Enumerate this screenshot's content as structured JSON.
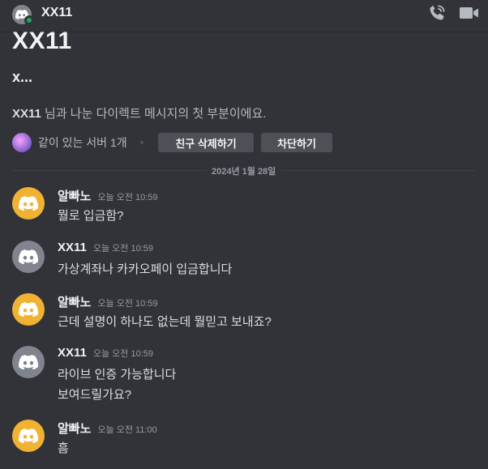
{
  "header": {
    "title": "XX11"
  },
  "profile": {
    "name": "XX11",
    "subname": "x...",
    "intro_name": "XX11",
    "intro_rest": " 님과 나눈 다이렉트 메시지의 첫 부분이에요.",
    "mutual_servers": "같이 있는 서버 1개",
    "remove_friend": "친구 삭제하기",
    "block": "차단하기"
  },
  "date_divider": "2024년 1월 28일",
  "messages": [
    {
      "author": "알빠노",
      "time": "오늘 오전 10:59",
      "avatar_color": "yellow",
      "lines": [
        "뭘로 입금함?"
      ]
    },
    {
      "author": "XX11",
      "time": "오늘 오전 10:59",
      "avatar_color": "gray",
      "lines": [
        "가상계좌나 카카오페이 입금합니다"
      ]
    },
    {
      "author": "알빠노",
      "time": "오늘 오전 10:59",
      "avatar_color": "yellow",
      "lines": [
        "근데 설명이 하나도 없는데 뭘믿고 보내죠?"
      ]
    },
    {
      "author": "XX11",
      "time": "오늘 오전 10:59",
      "avatar_color": "gray",
      "lines": [
        "라이브 인증 가능합니다",
        "보여드릴가요?"
      ]
    },
    {
      "author": "알빠노",
      "time": "오늘 오전 11:00",
      "avatar_color": "yellow",
      "lines": [
        "흠"
      ]
    }
  ],
  "icons": {
    "discord": "discord-logo-icon",
    "call": "phone-call-icon",
    "video": "video-camera-icon",
    "server": "server-icon"
  },
  "colors": {
    "background": "#313338",
    "online": "#23a55a",
    "avatar_yellow": "#f0b232",
    "avatar_gray": "#80848e",
    "button": "#4e5058"
  }
}
